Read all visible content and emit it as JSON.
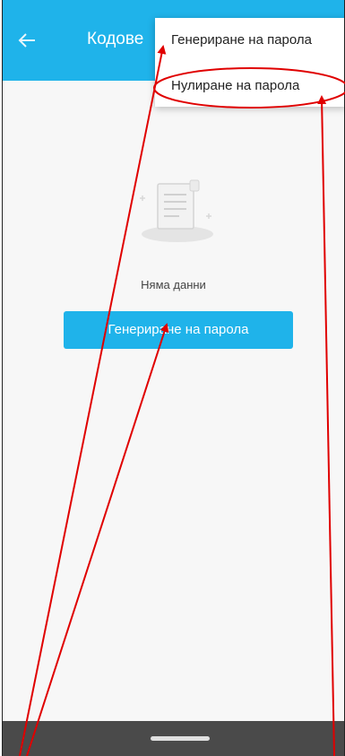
{
  "app_bar": {
    "title": "Кодове",
    "back_icon": "arrow-left-icon",
    "color": "#1fb3ea"
  },
  "menu": {
    "items": [
      {
        "label": "Генериране на парола"
      },
      {
        "label": "Нулиране на парола"
      }
    ]
  },
  "empty_state": {
    "icon": "empty-document-icon",
    "text": "Няма данни"
  },
  "primary_button": {
    "label": "Генериране на парола"
  },
  "annotations": {
    "color": "#e00000",
    "highlight_shape": "ellipse"
  },
  "system_nav": {
    "handle": "gesture-handle"
  }
}
